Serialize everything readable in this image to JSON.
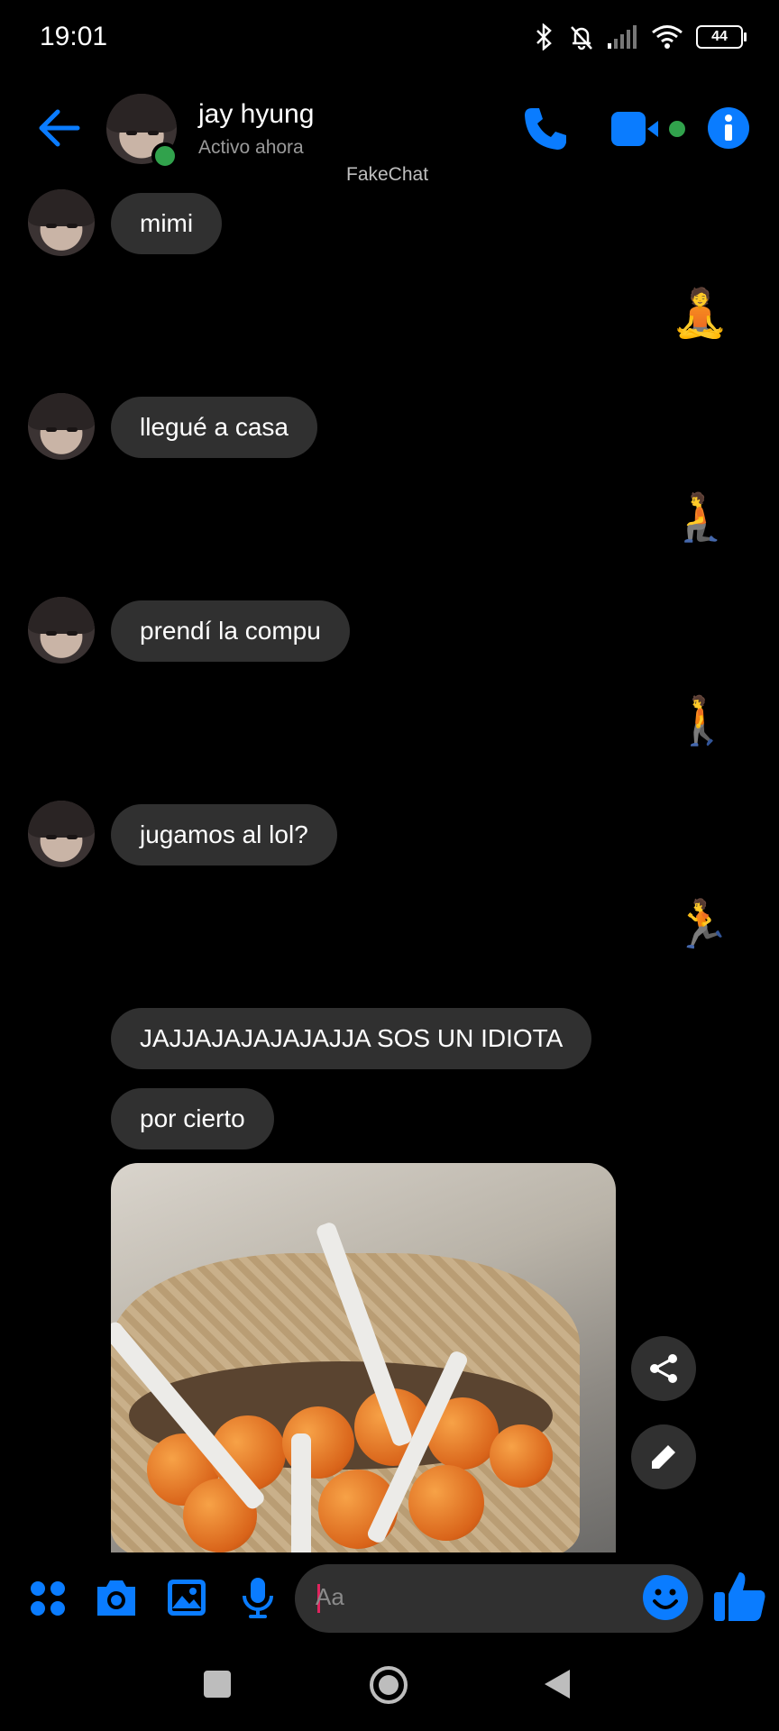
{
  "status_bar": {
    "time": "19:01",
    "battery": "44"
  },
  "header": {
    "contact_name": "jay hyung",
    "status": "Activo ahora",
    "watermark": "FakeChat"
  },
  "messages": [
    {
      "side": "left",
      "type": "text",
      "text": "mimi"
    },
    {
      "side": "right",
      "type": "emoji",
      "text": "🧘"
    },
    {
      "side": "left",
      "type": "text",
      "text": "llegué a casa"
    },
    {
      "side": "right",
      "type": "emoji",
      "text": "🧎"
    },
    {
      "side": "left",
      "type": "text",
      "text": "prendí la compu"
    },
    {
      "side": "right",
      "type": "emoji",
      "text": "🚶"
    },
    {
      "side": "left",
      "type": "text",
      "text": "jugamos al lol?"
    },
    {
      "side": "right",
      "type": "emoji",
      "text": "🏃"
    },
    {
      "side": "left",
      "type": "text",
      "text": "JAJJAJAJAJAJAJJA SOS UN IDIOTA"
    },
    {
      "side": "left",
      "type": "text",
      "text": "por cierto"
    },
    {
      "side": "left",
      "type": "image",
      "text": ""
    }
  ],
  "composer": {
    "placeholder": "Aa"
  },
  "colors": {
    "accent": "#0a7cff",
    "bubble": "#303030",
    "online": "#31a24c"
  },
  "icons": [
    "back-arrow-icon",
    "phone-icon",
    "video-icon",
    "info-icon",
    "share-icon",
    "edit-icon",
    "apps-icon",
    "camera-icon",
    "gallery-icon",
    "mic-icon",
    "emoji-icon",
    "thumbs-up-icon"
  ]
}
